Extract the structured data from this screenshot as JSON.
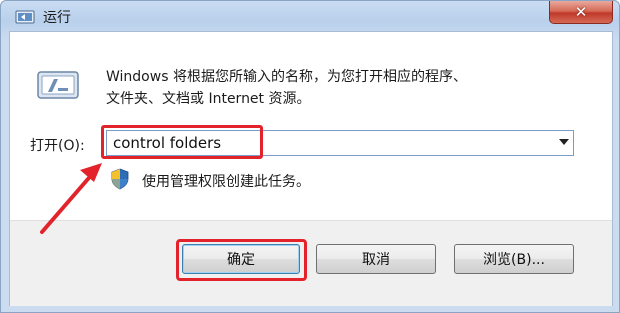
{
  "window": {
    "title": "运行",
    "close_symbol": "✕",
    "icon": "run-dialog-icon"
  },
  "dialog": {
    "description_line1": "Windows 将根据您所输入的名称，为您打开相应的程序、",
    "description_line2": "文件夹、文档或 Internet 资源。",
    "open_label": "打开(O):",
    "input_value": "control folders",
    "admin_note": "使用管理权限创建此任务。"
  },
  "buttons": {
    "ok": "确定",
    "cancel": "取消",
    "browse": "浏览(B)..."
  },
  "annotations": {
    "highlight_color": "#e3232b"
  }
}
